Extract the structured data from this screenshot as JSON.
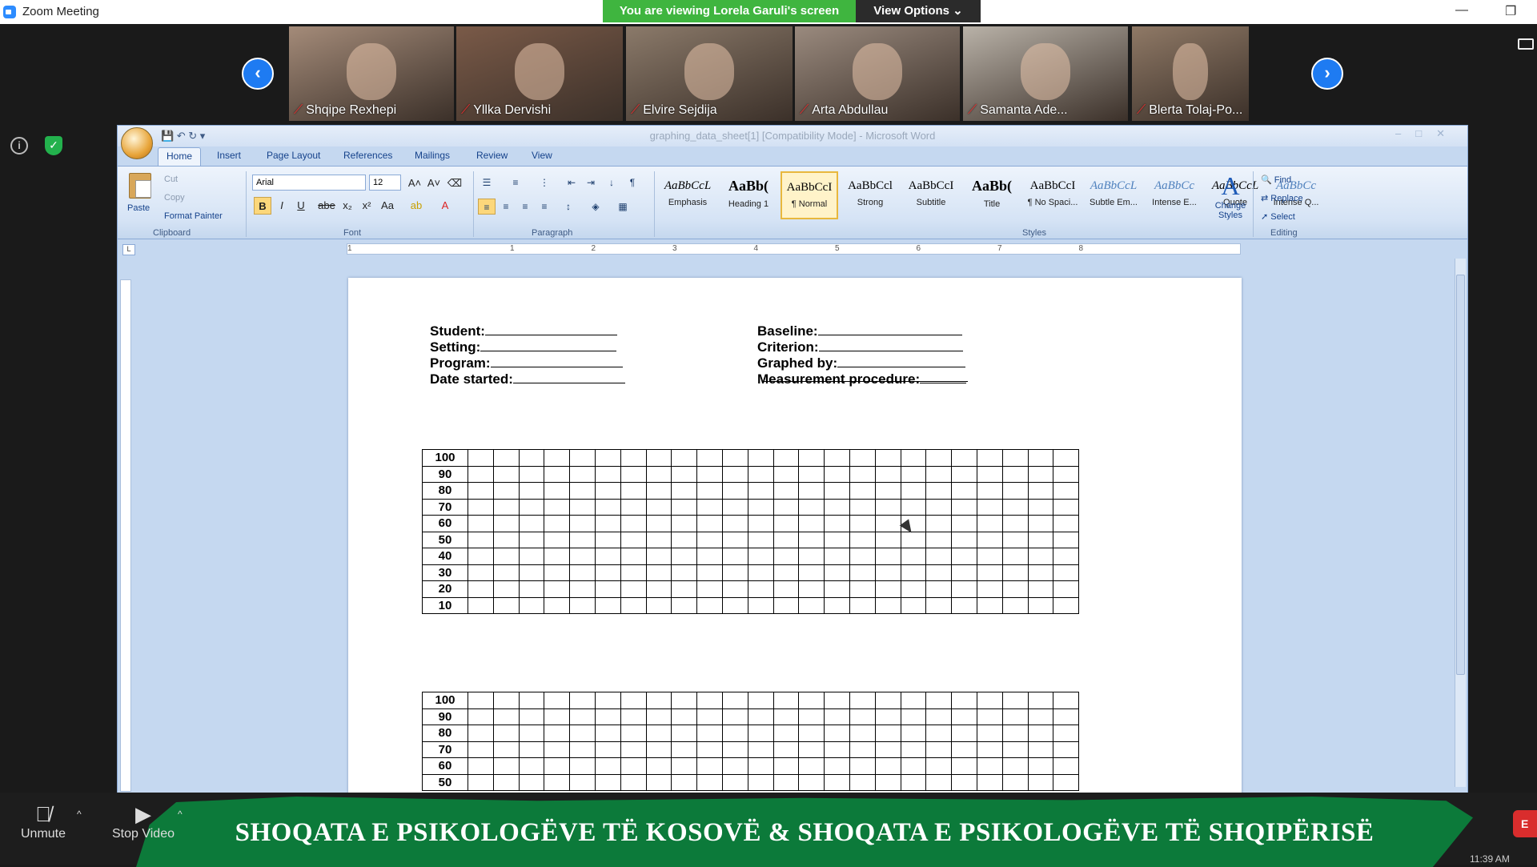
{
  "zoom": {
    "window_title": "Zoom Meeting",
    "banner": "You are viewing Lorela Garuli's screen",
    "view_options": "View Options ⌄",
    "participants": [
      {
        "name": "Shqipe Rexhepi",
        "tone": "#a48b79"
      },
      {
        "name": "Yllka Dervishi",
        "tone": "#7a5a48"
      },
      {
        "name": "Elvire Sejdija",
        "tone": "#8b7a6a"
      },
      {
        "name": "Arta Abdullau",
        "tone": "#9a8a7e"
      },
      {
        "name": "Samanta Ade...",
        "tone": "#b9b2a8"
      },
      {
        "name": "Blerta Tolaj-Po...",
        "tone": "#8f7966"
      }
    ],
    "controls": {
      "unmute": "Unmute",
      "stop_video": "Stop Video",
      "red_button": "E"
    },
    "clock": "11:39 AM"
  },
  "word": {
    "title": "graphing_data_sheet[1] [Compatibility Mode] - Microsoft Word",
    "tabs": [
      "Home",
      "Insert",
      "Page Layout",
      "References",
      "Mailings",
      "Review",
      "View"
    ],
    "clipboard": {
      "paste": "Paste",
      "cut": "Cut",
      "copy": "Copy",
      "format_painter": "Format Painter",
      "label": "Clipboard"
    },
    "font": {
      "name": "Arial",
      "size": "12",
      "label": "Font"
    },
    "paragraph": {
      "label": "Paragraph"
    },
    "styles": {
      "label": "Styles",
      "items": [
        {
          "sample": "AaBbCcL",
          "name": "Emphasis"
        },
        {
          "sample": "AaBb(",
          "name": "Heading 1"
        },
        {
          "sample": "AaBbCcI",
          "name": "¶ Normal"
        },
        {
          "sample": "AaBbCcl",
          "name": "Strong"
        },
        {
          "sample": "AaBbCcI",
          "name": "Subtitle"
        },
        {
          "sample": "AaBb(",
          "name": "Title"
        },
        {
          "sample": "AaBbCcI",
          "name": "¶ No Spaci..."
        },
        {
          "sample": "AaBbCcL",
          "name": "Subtle Em..."
        },
        {
          "sample": "AaBbCc",
          "name": "Intense E..."
        },
        {
          "sample": "AaBbCcL",
          "name": "Quote"
        },
        {
          "sample": "AaBbCc",
          "name": "Intense Q..."
        }
      ],
      "change_styles": "Change Styles"
    },
    "editing": {
      "find": "Find",
      "replace": "Replace",
      "select": "Select",
      "label": "Editing"
    },
    "ruler_numbers": [
      "1",
      "1",
      "2",
      "3",
      "4",
      "5",
      "6",
      "7",
      "8"
    ]
  },
  "document": {
    "left_fields": [
      {
        "label": "Student:",
        "blank_width": 165
      },
      {
        "label": "Setting:",
        "blank_width": 170
      },
      {
        "label": "Program:",
        "blank_width": 165
      },
      {
        "label": "Date started:",
        "blank_width": 140
      }
    ],
    "right_fields": [
      {
        "label": "Baseline:",
        "blank_width": 180
      },
      {
        "label": "Criterion:",
        "blank_width": 180
      },
      {
        "label": "Graphed by:",
        "blank_width": 160
      },
      {
        "label": "Measurement procedure:",
        "blank_width": 58
      }
    ],
    "grid1_rows": [
      "100",
      "90",
      "80",
      "70",
      "60",
      "50",
      "40",
      "30",
      "20",
      "10"
    ],
    "grid2_rows": [
      "100",
      "90",
      "80",
      "70",
      "60",
      "50"
    ]
  },
  "footer_banner": "SHOQATA E PSIKOLOGËVE TË KOSOVË & SHOQATA E PSIKOLOGËVE TË SHQIPËRISË"
}
